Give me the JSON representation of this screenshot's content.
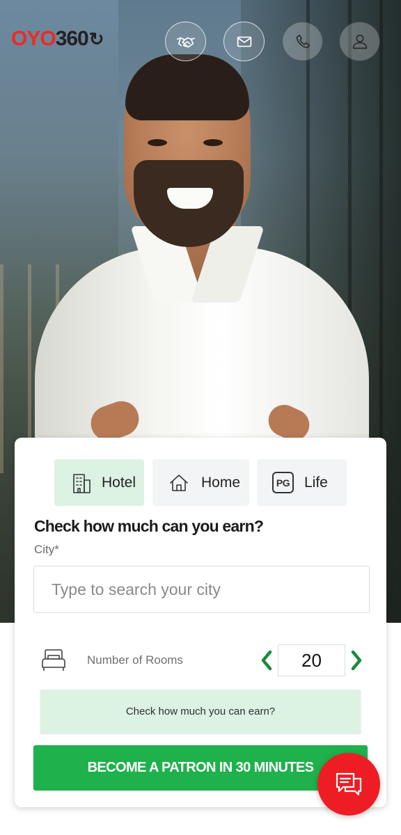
{
  "header": {
    "logo": {
      "brand": "OYO",
      "number": "360",
      "mark": "↻"
    },
    "icons": [
      {
        "name": "handshake-icon"
      },
      {
        "name": "mail-icon"
      },
      {
        "name": "phone-icon"
      },
      {
        "name": "user-icon"
      }
    ]
  },
  "property_types": [
    {
      "label": "Hotel",
      "icon": "building-icon",
      "selected": true
    },
    {
      "label": "Home",
      "icon": "home-icon",
      "selected": false
    },
    {
      "label": "Life",
      "icon_text": "PG",
      "selected": false
    }
  ],
  "form": {
    "heading": "Check how much can you earn?",
    "city_label": "City*",
    "city_placeholder": "Type to search your city",
    "rooms_label": "Number of Rooms",
    "rooms_value": "20",
    "earn_button": "Check how much you can earn?",
    "patron_button": "BECOME A PATRON IN 30 MINUTES"
  },
  "colors": {
    "brand_red": "#ee2a24",
    "primary_green": "#1fb14b",
    "light_green": "#dcf2e3",
    "chevron_green": "#1a8a3c"
  }
}
